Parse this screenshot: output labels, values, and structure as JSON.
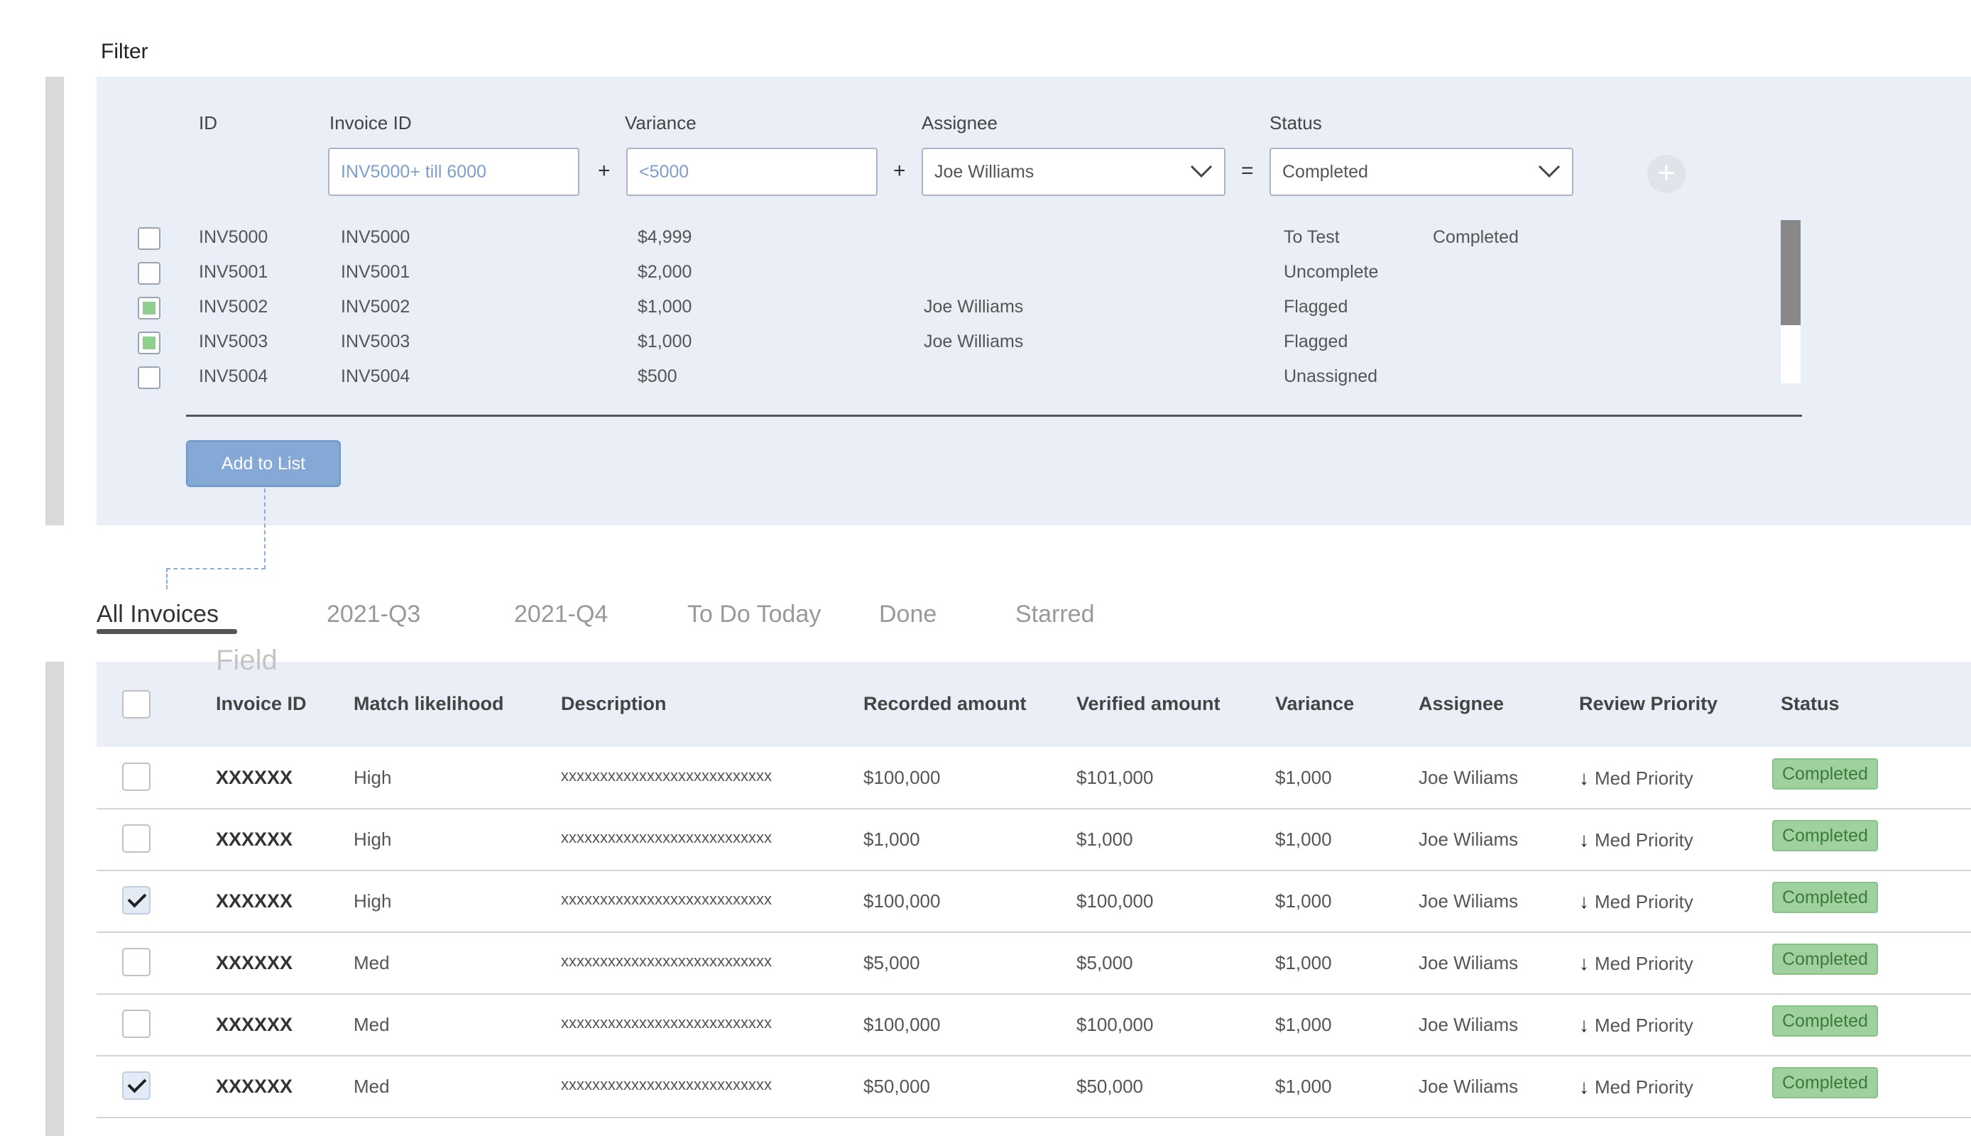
{
  "filter": {
    "title": "Filter",
    "labels": {
      "id": "ID",
      "invoice_id": "Invoice ID",
      "variance": "Variance",
      "assignee": "Assignee",
      "status": "Status"
    },
    "invoice_id_value": "INV5000+ till 6000",
    "variance_value": "<5000",
    "assignee_value": "Joe Williams",
    "status_value": "Completed",
    "op1": "+",
    "op2": "+",
    "op3": "=",
    "add_icon": "+",
    "rows": [
      {
        "id": "INV5000",
        "invoice": "INV5000",
        "variance": "$4,999",
        "assignee": "",
        "status": "To Test",
        "extra": "Completed",
        "checked": false
      },
      {
        "id": "INV5001",
        "invoice": "INV5001",
        "variance": "$2,000",
        "assignee": "",
        "status": "Uncomplete",
        "extra": "",
        "checked": false
      },
      {
        "id": "INV5002",
        "invoice": "INV5002",
        "variance": "$1,000",
        "assignee": "Joe Williams",
        "status": "Flagged",
        "extra": "",
        "checked": true
      },
      {
        "id": "INV5003",
        "invoice": "INV5003",
        "variance": "$1,000",
        "assignee": "Joe Williams",
        "status": "Flagged",
        "extra": "",
        "checked": true
      },
      {
        "id": "INV5004",
        "invoice": "INV5004",
        "variance": "$500",
        "assignee": "",
        "status": "Unassigned",
        "extra": "",
        "checked": false
      }
    ],
    "add_button": "Add to List"
  },
  "tabs": [
    "All Invoices",
    "2021-Q3",
    "2021-Q4",
    "To Do Today",
    "Done",
    "Starred"
  ],
  "ghost_label": "Field",
  "table": {
    "headers": [
      "Invoice ID",
      "Match likelihood",
      "Description",
      "Recorded amount",
      "Verified amount",
      "Variance",
      "Assignee",
      "Review Priority",
      "Status"
    ],
    "rows": [
      {
        "checked": false,
        "id": "XXXXXX",
        "match": "High",
        "desc": "xxxxxxxxxxxxxxxxxxxxxxxxxxx",
        "recorded": "$100,000",
        "verified": "$101,000",
        "variance": "$1,000",
        "assignee": "Joe Wiliams",
        "priority": "Med Priority",
        "status": "Completed"
      },
      {
        "checked": false,
        "id": "XXXXXX",
        "match": "High",
        "desc": "xxxxxxxxxxxxxxxxxxxxxxxxxxx",
        "recorded": "$1,000",
        "verified": "$1,000",
        "variance": "$1,000",
        "assignee": "Joe Wiliams",
        "priority": "Med Priority",
        "status": "Completed"
      },
      {
        "checked": true,
        "id": "XXXXXX",
        "match": "High",
        "desc": "xxxxxxxxxxxxxxxxxxxxxxxxxxx",
        "recorded": "$100,000",
        "verified": "$100,000",
        "variance": "$1,000",
        "assignee": "Joe Wiliams",
        "priority": "Med Priority",
        "status": "Completed"
      },
      {
        "checked": false,
        "id": "XXXXXX",
        "match": "Med",
        "desc": "xxxxxxxxxxxxxxxxxxxxxxxxxxx",
        "recorded": "$5,000",
        "verified": "$5,000",
        "variance": "$1,000",
        "assignee": "Joe Wiliams",
        "priority": "Med Priority",
        "status": "Completed"
      },
      {
        "checked": false,
        "id": "XXXXXX",
        "match": "Med",
        "desc": "xxxxxxxxxxxxxxxxxxxxxxxxxxx",
        "recorded": "$100,000",
        "verified": "$100,000",
        "variance": "$1,000",
        "assignee": "Joe Wiliams",
        "priority": "Med Priority",
        "status": "Completed"
      },
      {
        "checked": true,
        "id": "XXXXXX",
        "match": "Med",
        "desc": "xxxxxxxxxxxxxxxxxxxxxxxxxxx",
        "recorded": "$50,000",
        "verified": "$50,000",
        "variance": "$1,000",
        "assignee": "Joe Wiliams",
        "priority": "Med Priority",
        "status": "Completed"
      }
    ]
  },
  "icons": {
    "priority": "arrow-down-icon",
    "dropdown": "chevron-down-icon",
    "add": "plus-circle-icon"
  },
  "colors": {
    "accent": "#84a9d7",
    "panel": "#eaeef6",
    "badge": "#9ed19e"
  }
}
